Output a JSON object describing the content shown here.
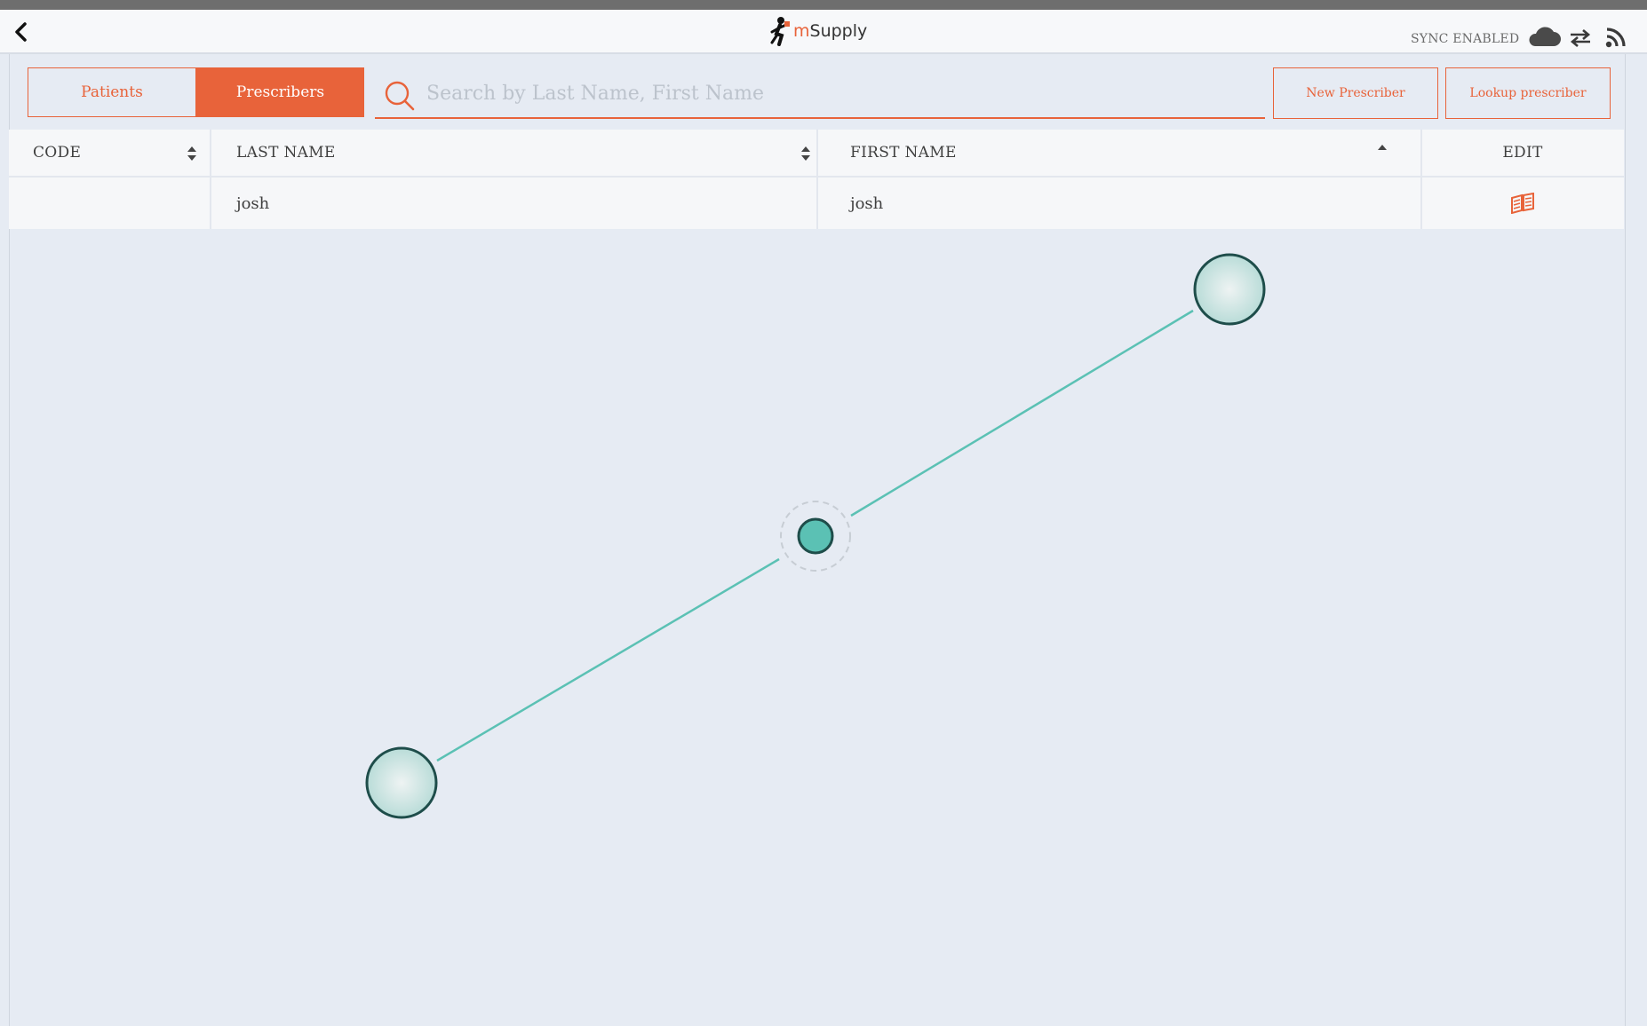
{
  "app": {
    "logo_prefix": "m",
    "logo_suffix": "Supply"
  },
  "header": {
    "sync_label": "SYNC ENABLED",
    "back_icon": "back-arrow-icon",
    "icons": [
      "cloud-icon",
      "sync-arrows-icon",
      "rss-icon"
    ]
  },
  "tabs": [
    {
      "label": "Patients",
      "active": false
    },
    {
      "label": "Prescribers",
      "active": true
    }
  ],
  "search": {
    "placeholder": "Search by Last Name, First Name",
    "value": ""
  },
  "actions": {
    "new_label": "New Prescriber",
    "lookup_label": "Lookup prescriber"
  },
  "table": {
    "columns": [
      "CODE",
      "LAST NAME",
      "FIRST NAME",
      "EDIT"
    ],
    "rows": [
      {
        "code": "",
        "last_name": "josh",
        "first_name": "josh",
        "edit_icon": "edit-book-icon"
      }
    ]
  },
  "colors": {
    "accent": "#e8633a",
    "background": "#e6ebf3",
    "gesture": "#5bc1b4"
  }
}
